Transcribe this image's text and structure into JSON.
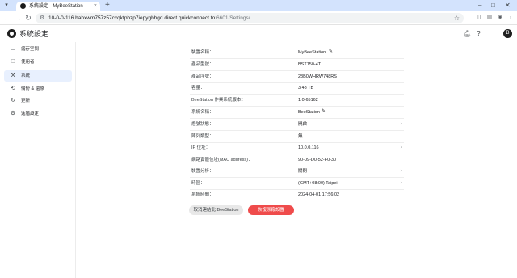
{
  "browser": {
    "tab_title": "系統設定 - MyBeeStation",
    "tab_close": "×",
    "new_tab": "+",
    "url_host": "10-0-0-116.hahxwm757z57cxqktpbzp7iepygbhgd.direct.quickconnect.to",
    "url_path": ":6601/Settings/",
    "window_controls": [
      "–",
      "□",
      "✕"
    ]
  },
  "app": {
    "title": "系統設定",
    "icons": [
      "notification-icon",
      "help-icon",
      "account-icon"
    ],
    "avatar_letter": "B"
  },
  "sidebar": {
    "items": [
      {
        "label": "儲存空間",
        "icon": "storage-icon",
        "active": false
      },
      {
        "label": "使用者",
        "icon": "user-icon",
        "active": false
      },
      {
        "label": "系統",
        "icon": "system-icon",
        "active": true
      },
      {
        "label": "備份 & 還原",
        "icon": "backup-icon",
        "active": false
      },
      {
        "label": "更新",
        "icon": "update-icon",
        "active": false
      },
      {
        "label": "進階設定",
        "icon": "advanced-settings-icon",
        "active": false
      }
    ]
  },
  "settings": {
    "rows": [
      {
        "label": "裝置名稱：",
        "value": "MyBeeStation",
        "editable": true,
        "chevron": false
      },
      {
        "label": "產品型號：",
        "value": "BST150-4T",
        "editable": false,
        "chevron": false
      },
      {
        "label": "產品序號：",
        "value": "23B0WHRW748RS",
        "editable": false,
        "chevron": false
      },
      {
        "label": "容量：",
        "value": "3.48 TB",
        "editable": false,
        "chevron": false
      },
      {
        "label": "BeeStation 作業系統版本：",
        "value": "1.0-65162",
        "editable": false,
        "chevron": false
      },
      {
        "label": "系統名稱：",
        "value": "BeeStation",
        "editable": true,
        "chevron": false
      },
      {
        "label": "燈號狀態：",
        "value": "開啟",
        "editable": false,
        "chevron": true
      },
      {
        "label": "陣列類型：",
        "value": "無",
        "editable": false,
        "chevron": false
      },
      {
        "label": "IP 位址：",
        "value": "10.0.0.116",
        "editable": false,
        "chevron": true
      },
      {
        "label": "網路實體位址(MAC address)：",
        "value": "90-09-D0-52-F0-30",
        "editable": false,
        "chevron": false
      },
      {
        "label": "裝置分析：",
        "value": "關閉",
        "editable": false,
        "chevron": true
      },
      {
        "label": "時區：",
        "value": "(GMT+08:00) Taipei",
        "editable": false,
        "chevron": true
      },
      {
        "label": "系統時間：",
        "value": "2024-04-01 17:56:02",
        "editable": false,
        "chevron": false
      }
    ],
    "unbind_button": "取消連結此 BeeStation",
    "reset_button": "恢復原廠設置"
  },
  "colors": {
    "accent_red": "#ef4b4b",
    "active_nav": "#e8f0fe",
    "tab_strip": "#d3e3fd"
  }
}
